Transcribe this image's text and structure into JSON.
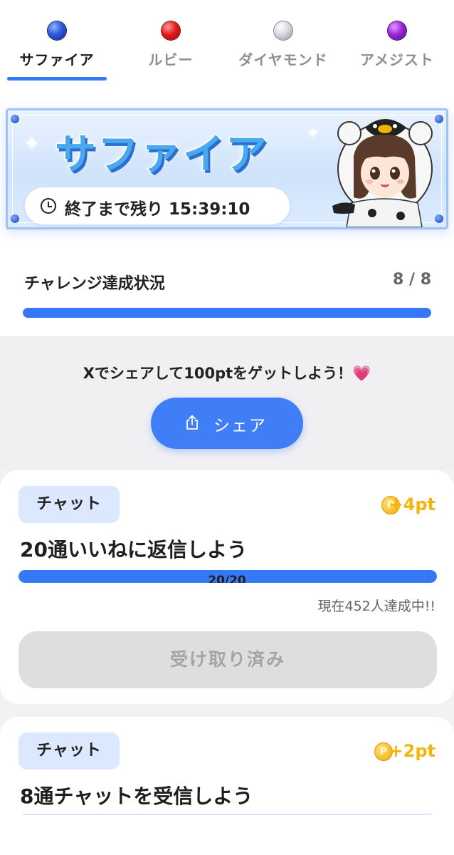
{
  "tabs": [
    {
      "label": "サファイア",
      "gem_icon": "sapphire-gem-icon",
      "color": "#1f3fbf",
      "active": true
    },
    {
      "label": "ルビー",
      "gem_icon": "ruby-gem-icon",
      "color": "#e01818",
      "active": false
    },
    {
      "label": "ダイヤモンド",
      "gem_icon": "diamond-gem-icon",
      "color": "#c8ccd4",
      "active": false
    },
    {
      "label": "アメジスト",
      "gem_icon": "amethyst-gem-icon",
      "color": "#8a1fc8",
      "active": false
    }
  ],
  "banner": {
    "title": "サファイア",
    "timer_text": "終了まで残り 15:39:10",
    "timer_icon": "clock-icon"
  },
  "progress": {
    "title": "チャレンジ達成状況",
    "count": "8 / 8",
    "fraction": 1.0
  },
  "share": {
    "text": "Xでシェアして100ptをゲットしよう！",
    "heart": "💗",
    "button_label": "シェア",
    "button_icon": "share-icon"
  },
  "challenges": [
    {
      "category": "チャット",
      "reward": "+4pt",
      "coin_letter": "P",
      "title": "20通いいねに返信しよう",
      "progress_label": "20/20",
      "progress_fraction": 1.0,
      "achieved_text": "現在452人達成中!!",
      "button_label": "受け取り済み"
    },
    {
      "category": "チャット",
      "reward": "+2pt",
      "coin_letter": "P",
      "title": "8通チャットを受信しよう"
    }
  ],
  "colors": {
    "accent": "#3478f6",
    "reward": "#f5b40a",
    "tag_bg": "#dbe8fd"
  }
}
